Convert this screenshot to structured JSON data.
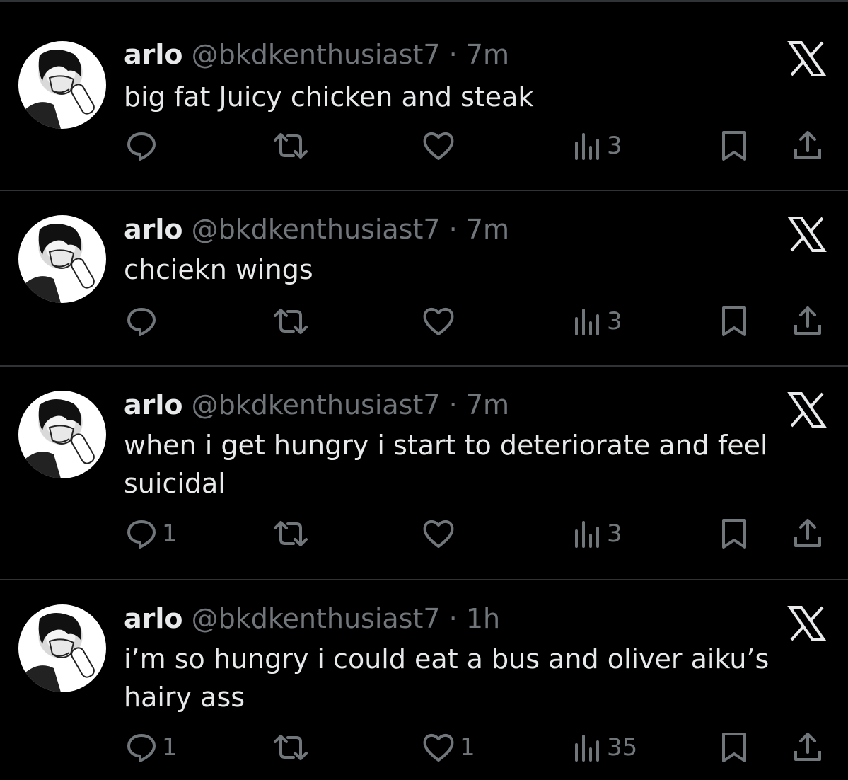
{
  "colors": {
    "background": "#000000",
    "text": "#e7e9ea",
    "muted": "#71767b",
    "divider": "#2f3336"
  },
  "tweets": [
    {
      "name": "arlo",
      "handle": "@bkdkenthusiast7",
      "separator": "·",
      "time": "7m",
      "text": "big fat Juicy chicken and steak",
      "replies": "",
      "reposts": "",
      "likes": "",
      "views": "3"
    },
    {
      "name": "arlo",
      "handle": "@bkdkenthusiast7",
      "separator": "·",
      "time": "7m",
      "text": "chciekn wings",
      "replies": "",
      "reposts": "",
      "likes": "",
      "views": "3"
    },
    {
      "name": "arlo",
      "handle": "@bkdkenthusiast7",
      "separator": "·",
      "time": "7m",
      "text": "when i get hungry i start to deteriorate and feel suicidal",
      "replies": "1",
      "reposts": "",
      "likes": "",
      "views": "3"
    },
    {
      "name": "arlo",
      "handle": "@bkdkenthusiast7",
      "separator": "·",
      "time": "1h",
      "text": "i’m so hungry i could eat a bus and oliver aiku’s hairy ass",
      "replies": "1",
      "reposts": "",
      "likes": "1",
      "views": "35"
    }
  ],
  "icons": [
    "x-logo-icon",
    "reply-icon",
    "repost-icon",
    "like-icon",
    "views-icon",
    "bookmark-icon",
    "share-icon"
  ]
}
